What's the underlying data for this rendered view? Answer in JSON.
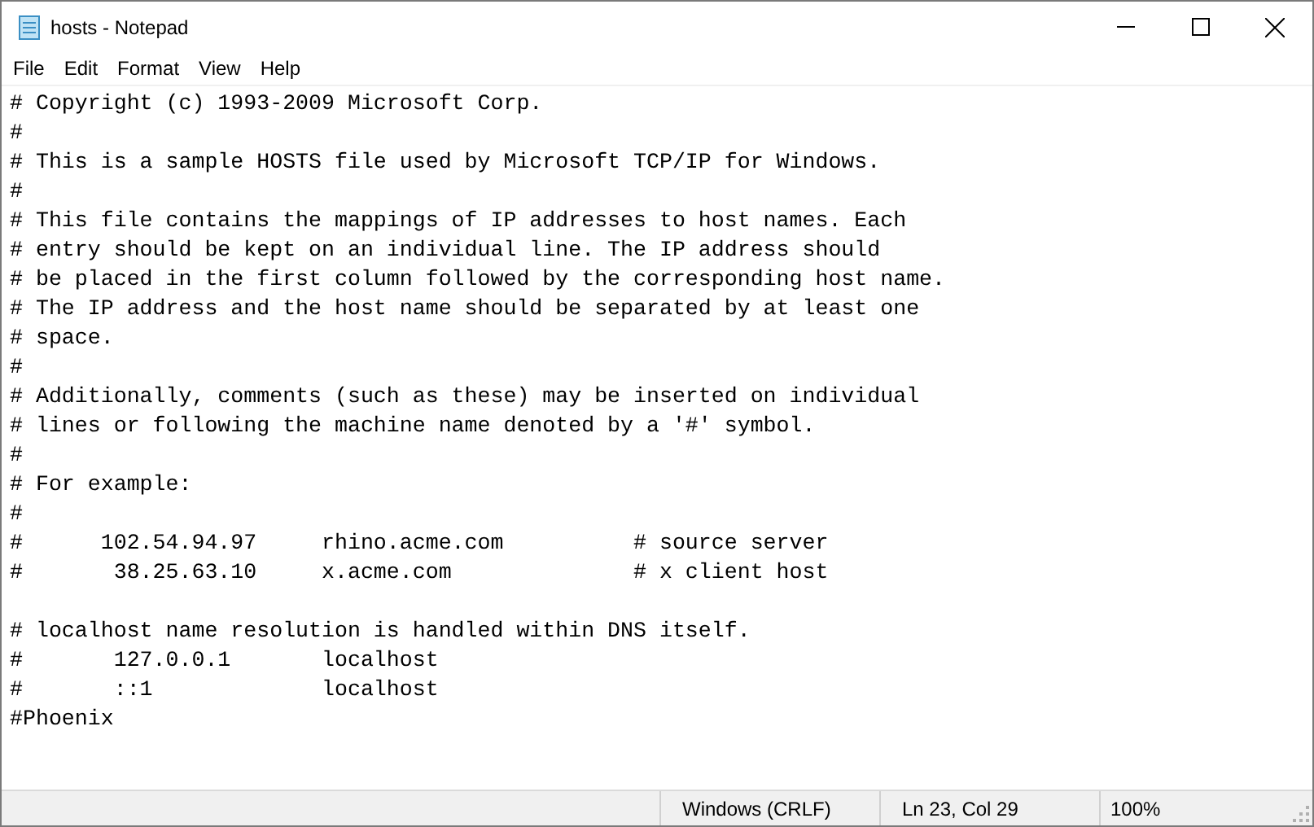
{
  "window": {
    "title": "hosts - Notepad"
  },
  "menu": [
    {
      "label": "File"
    },
    {
      "label": "Edit"
    },
    {
      "label": "Format"
    },
    {
      "label": "View"
    },
    {
      "label": "Help"
    }
  ],
  "editor": {
    "text": "# Copyright (c) 1993-2009 Microsoft Corp.\n#\n# This is a sample HOSTS file used by Microsoft TCP/IP for Windows.\n#\n# This file contains the mappings of IP addresses to host names. Each\n# entry should be kept on an individual line. The IP address should\n# be placed in the first column followed by the corresponding host name.\n# The IP address and the host name should be separated by at least one\n# space.\n#\n# Additionally, comments (such as these) may be inserted on individual\n# lines or following the machine name denoted by a '#' symbol.\n#\n# For example:\n#\n#      102.54.94.97     rhino.acme.com          # source server\n#       38.25.63.10     x.acme.com              # x client host\n\n# localhost name resolution is handled within DNS itself.\n#       127.0.0.1       localhost\n#       ::1             localhost\n#Phoenix"
  },
  "status_bar": [
    {
      "text": "Windows (CRLF)"
    },
    {
      "text": "Ln 23, Col 29"
    },
    {
      "text": "100%"
    }
  ]
}
